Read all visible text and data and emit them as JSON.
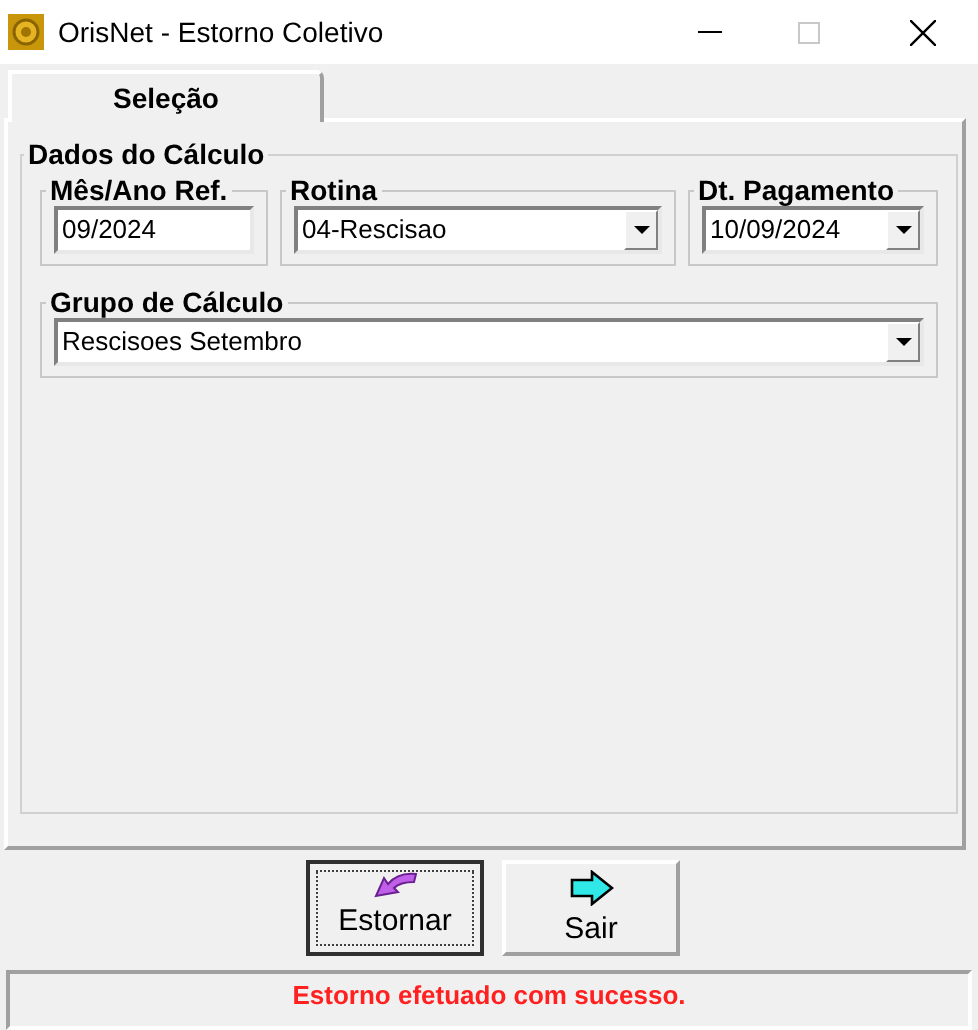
{
  "window": {
    "title": "OrisNet - Estorno Coletivo"
  },
  "tabs": [
    {
      "label": "Seleção",
      "selected": true
    }
  ],
  "group": {
    "title": "Dados do Cálculo",
    "fields": [
      {
        "label": "Mês/Ano Ref.",
        "value": "09/2024",
        "kind": "text"
      },
      {
        "label": "Rotina",
        "value": "04-Rescisao",
        "kind": "dropdown"
      },
      {
        "label": "Dt. Pagamento",
        "value": "10/09/2024",
        "kind": "dropdown"
      },
      {
        "label": "Grupo de Cálculo",
        "value": "Rescisoes Setembro",
        "kind": "dropdown"
      }
    ]
  },
  "buttons": [
    {
      "label": "Estornar",
      "kind": "undo",
      "focused": true
    },
    {
      "label": "Sair",
      "kind": "exit",
      "focused": false
    }
  ],
  "status": {
    "message": "Estorno efetuado com sucesso."
  }
}
